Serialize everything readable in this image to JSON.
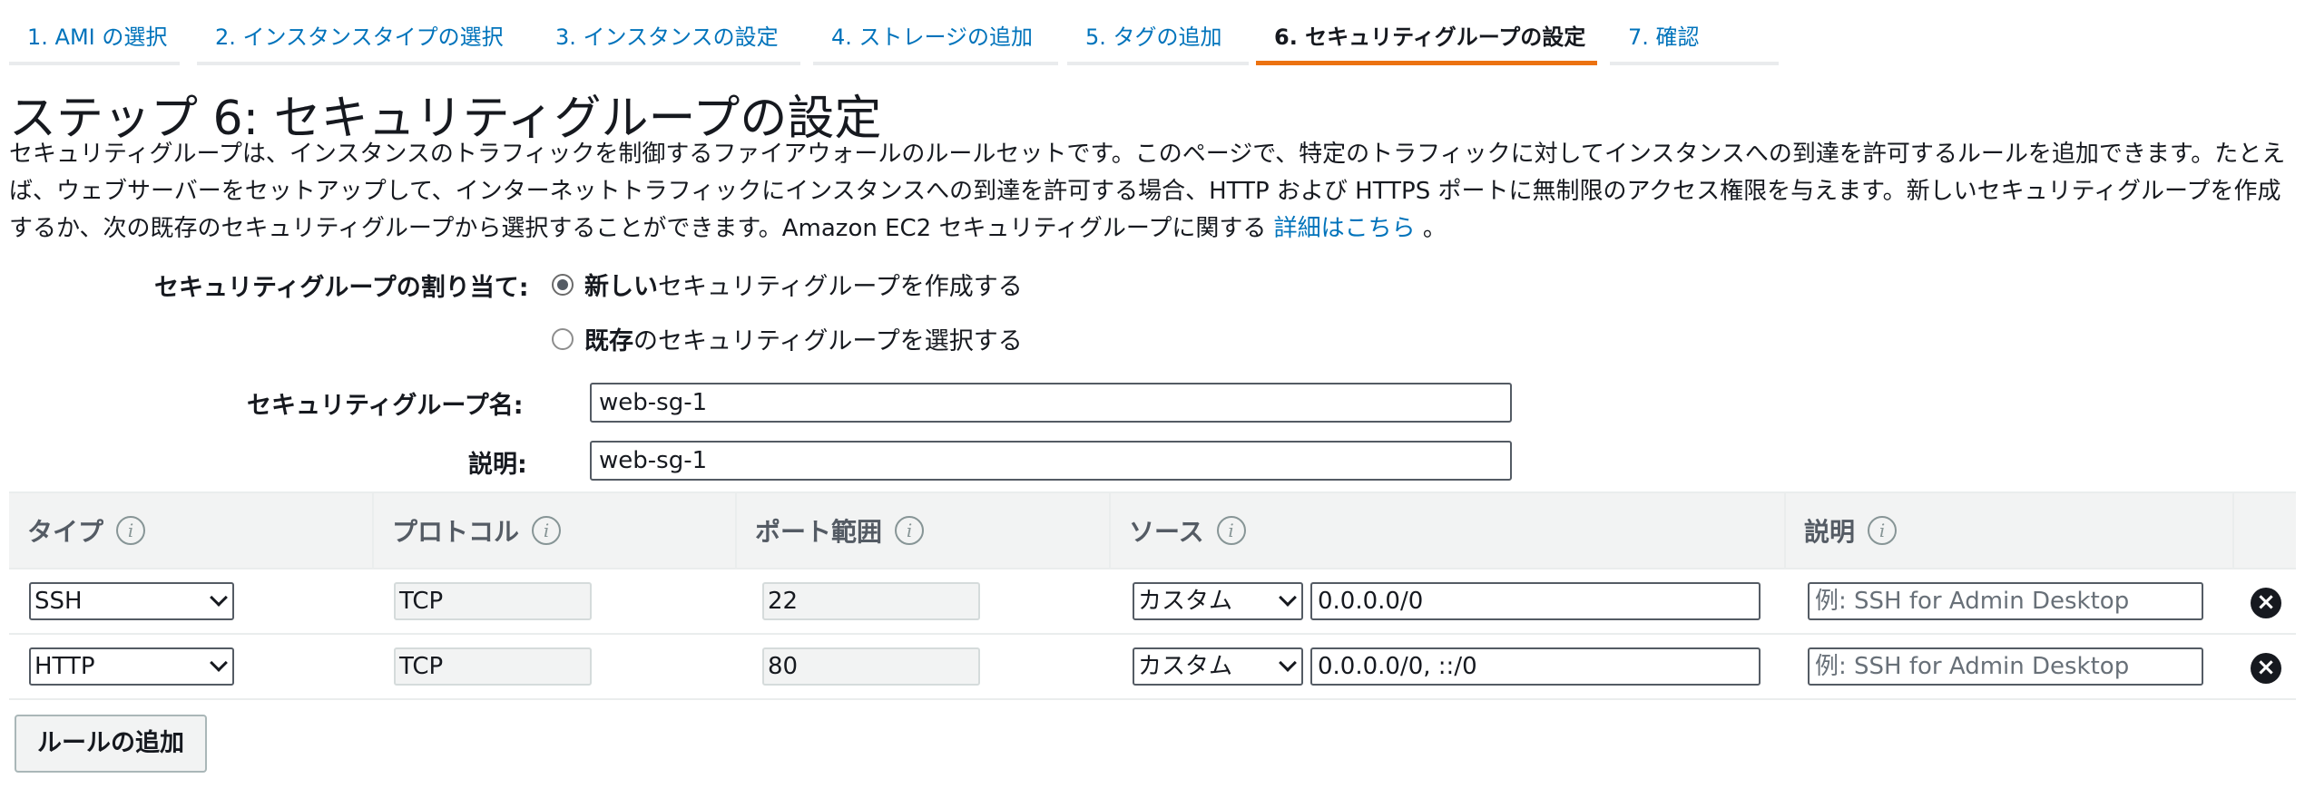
{
  "tabs": [
    {
      "label": "1. AMI の選択",
      "active": false
    },
    {
      "label": "2. インスタンスタイプの選択",
      "active": false
    },
    {
      "label": "3. インスタンスの設定",
      "active": false
    },
    {
      "label": "4. ストレージの追加",
      "active": false
    },
    {
      "label": "5. タグの追加",
      "active": false
    },
    {
      "label": "6. セキュリティグループの設定",
      "active": true
    },
    {
      "label": "7. 確認",
      "active": false
    }
  ],
  "page": {
    "title": "ステップ 6: セキュリティグループの設定",
    "description": "セキュリティグループは、インスタンスのトラフィックを制御するファイアウォールのルールセットです。このページで、特定のトラフィックに対してインスタンスへの到達を許可するルールを追加できます。たとえば、ウェブサーバーをセットアップして、インターネットトラフィックにインスタンスへの到達を許可する場合、HTTP および HTTPS ポートに無制限のアクセス権限を与えます。新しいセキュリティグループを作成するか、次の既存のセキュリティグループから選択することができます。Amazon EC2 セキュリティグループに関する ",
    "learn_more_link": "詳細はこちら",
    "description_end": " 。"
  },
  "assignment": {
    "label": "セキュリティグループの割り当て:",
    "option_new_bold": "新しい",
    "option_new_rest": "セキュリティグループを作成する",
    "option_existing_bold": "既存",
    "option_existing_rest": "のセキュリティグループを選択する",
    "selected": "new"
  },
  "group_name": {
    "label": "セキュリティグループ名:",
    "value": "web-sg-1"
  },
  "group_description": {
    "label": "説明:",
    "value": "web-sg-1"
  },
  "table": {
    "headers": {
      "type": "タイプ",
      "protocol": "プロトコル",
      "port_range": "ポート範囲",
      "source": "ソース",
      "description": "説明"
    },
    "info_glyph": "i",
    "rows": [
      {
        "type": "SSH",
        "protocol": "TCP",
        "port": "22",
        "source_type": "カスタム",
        "source": "0.0.0.0/0",
        "description_placeholder": "例: SSH for Admin Desktop"
      },
      {
        "type": "HTTP",
        "protocol": "TCP",
        "port": "80",
        "source_type": "カスタム",
        "source": "0.0.0.0/0, ::/0",
        "description_placeholder": "例: SSH for Admin Desktop"
      }
    ],
    "delete_glyph": "×"
  },
  "add_rule_button": "ルールの追加",
  "colors": {
    "link": "#0073bb",
    "active_tab_underline": "#ec7211",
    "header_bg": "#f2f3f3"
  }
}
